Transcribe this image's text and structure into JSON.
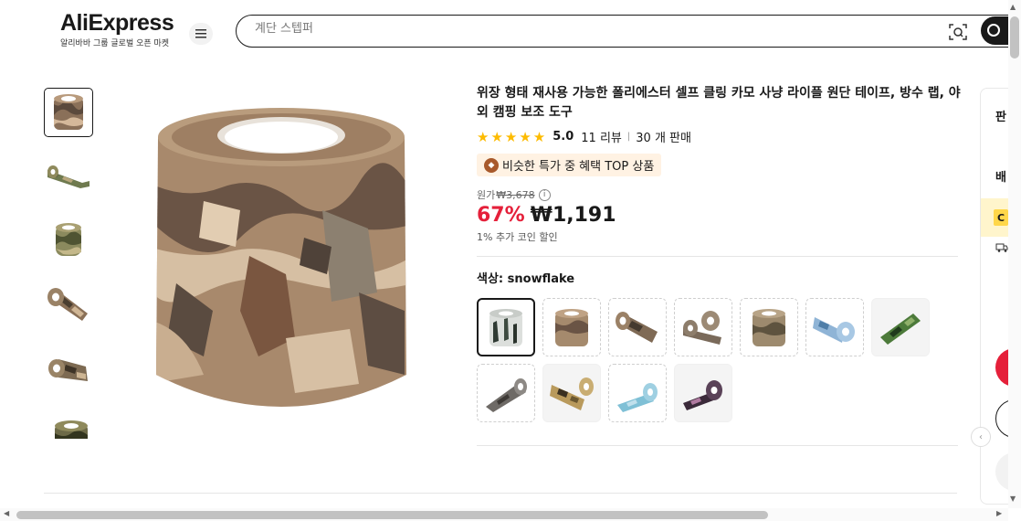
{
  "header": {
    "logo_text": "AliExpress",
    "logo_sub": "알리바바 그룹 글로벌 오픈 마켓",
    "search_placeholder": "계단 스텝퍼"
  },
  "icons": {
    "menu": "menu-icon",
    "camera_search": "image-search-icon",
    "search": "search-icon",
    "info": "info-icon"
  },
  "product": {
    "title": "위장 형태 재사용 가능한 폴리에스터 셀프 클링 카모 사냥 라이플 원단 테이프, 방수 랩, 야외 캠핑 보조 도구",
    "stars": "★★★★★",
    "rating": "5.0",
    "reviews": "11 리뷰",
    "sold": "30 개 판매",
    "badge": "비슷한 특가 중 혜택 TOP 상품",
    "original_label": "원가",
    "original_price": "₩3,678",
    "discount": "67%",
    "price": "₩1,191",
    "coin_note": "1% 추가 코인 할인",
    "color_label": "색상: ",
    "color_value": "snowflake"
  },
  "side": {
    "text1": "판",
    "text2": "배",
    "coupon": "C"
  },
  "colors": {
    "accent_red": "#e5203a",
    "star": "#fdbb00",
    "badge_bg": "#fff2e3"
  }
}
